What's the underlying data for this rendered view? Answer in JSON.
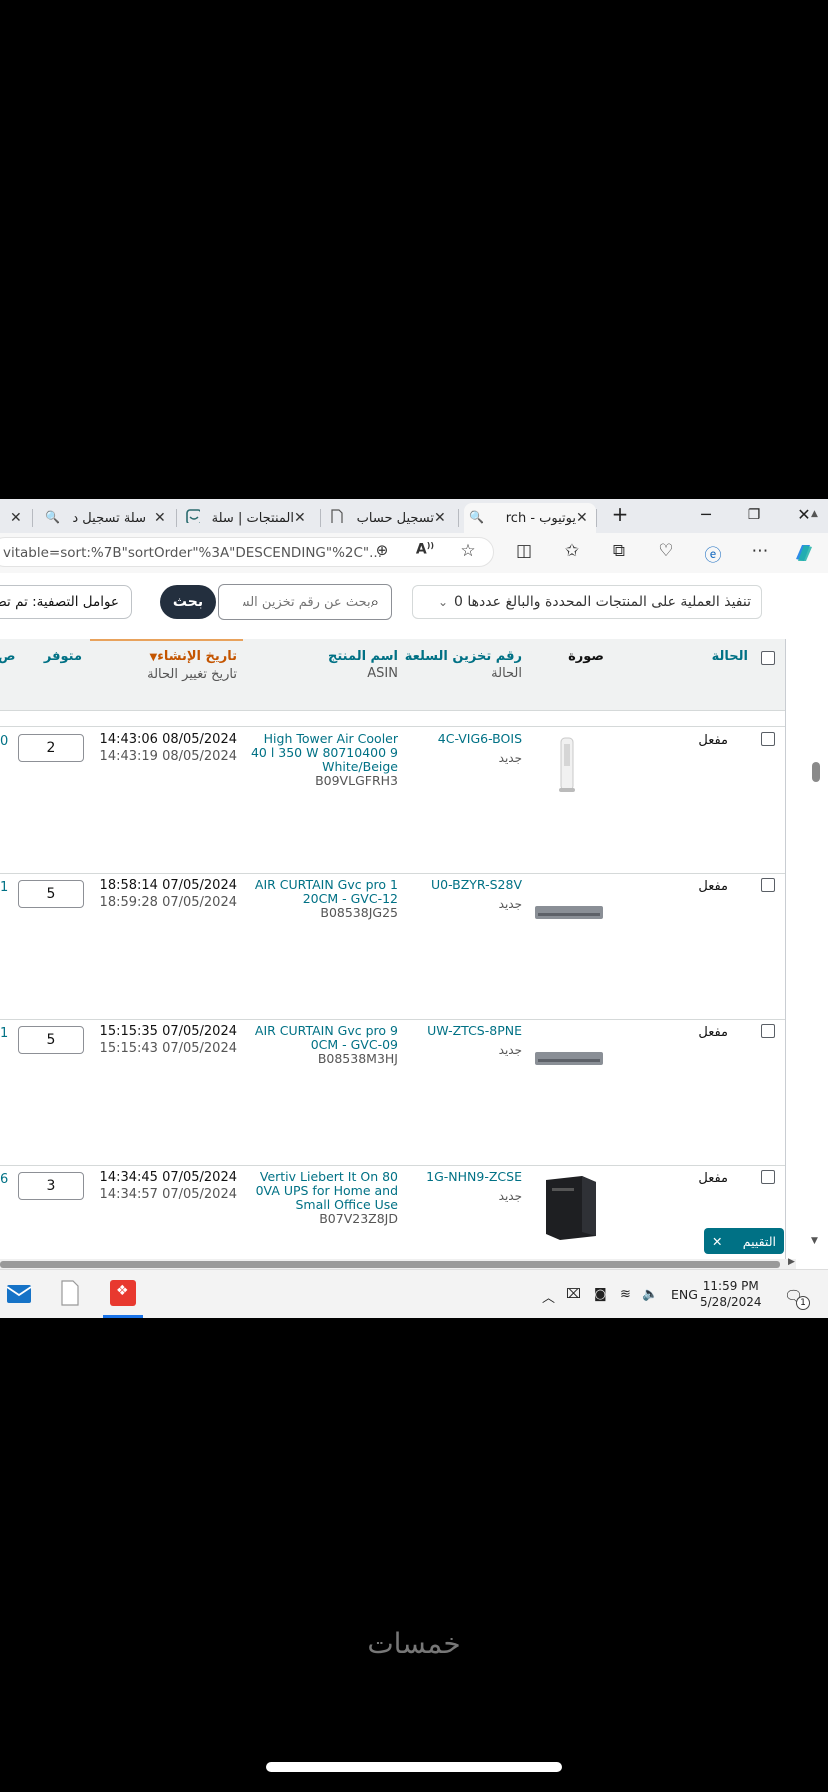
{
  "browser": {
    "tabs": [
      {
        "label": "يوتيوب - rch"
      },
      {
        "label": "تسجيل حساب"
      },
      {
        "label": "المنتجات | سلة"
      },
      {
        "label": "سلة تسجيل د"
      }
    ],
    "new_tab_label": "+",
    "url": "vitable=sort:%7B\"sortOrder\"%3A\"DESCENDING\"%2C\"..."
  },
  "toolbar": {
    "bulk_action_label": "تنفيذ العملية على المنتجات المحددة والبالغ عددها 0",
    "search_placeholder": "بحث عن رقم تخزين السلعة",
    "search_button": "بحث",
    "filters_label": "عوامل التصفية: تم تط"
  },
  "table": {
    "headers": {
      "status": "الحالة",
      "image": "صورة",
      "sku": "رقم تخزين السلعة",
      "sku_sub": "الحالة",
      "name": "اسم المنتج",
      "name_sub": "ASIN",
      "created": "تاريخ الإنشاء",
      "created_sub": "تاريخ تغيير الحالة",
      "available": "متوفر"
    },
    "rows": [
      {
        "status": "مفعل",
        "sku": "4C-VIG6-BOIS",
        "condition": "جديد",
        "name": "High Tower Air Cooler 40 l 350 W 80710400 9 White/Beige",
        "asin": "B09VLGFRH3",
        "created": "14:43:06 08/05/2024",
        "changed": "14:43:19 08/05/2024",
        "qty": "2",
        "edge": "0"
      },
      {
        "status": "مفعل",
        "sku": "U0-BZYR-S28V",
        "condition": "جديد",
        "name": "AIR CURTAIN Gvc pro 1 20CM - GVC-12",
        "asin": "B08538JG25",
        "created": "18:58:14 07/05/2024",
        "changed": "18:59:28 07/05/2024",
        "qty": "5",
        "edge": "1"
      },
      {
        "status": "مفعل",
        "sku": "UW-ZTCS-8PNE",
        "condition": "جديد",
        "name": "AIR CURTAIN Gvc pro 9 0CM - GVC-09",
        "asin": "B08538M3HJ",
        "created": "15:15:35 07/05/2024",
        "changed": "15:15:43 07/05/2024",
        "qty": "5",
        "edge": "1"
      },
      {
        "status": "مفعل",
        "sku": "1G-NHN9-ZCSE",
        "condition": "جديد",
        "name": "Vertiv Liebert It On 80 0VA UPS for Home and Small Office Use",
        "asin": "B07V23Z8JD",
        "created": "14:34:45 07/05/2024",
        "changed": "14:34:57 07/05/2024",
        "qty": "3",
        "edge": "6"
      }
    ]
  },
  "rating_pill": "التقييم",
  "taskbar": {
    "language": "ENG",
    "time": "11:59 PM",
    "date": "5/28/2024",
    "notification_count": "1"
  },
  "watermark": "خمسات",
  "colors": {
    "link": "#007185",
    "sorted_header": "#c45500",
    "search_button": "#232f3e"
  }
}
